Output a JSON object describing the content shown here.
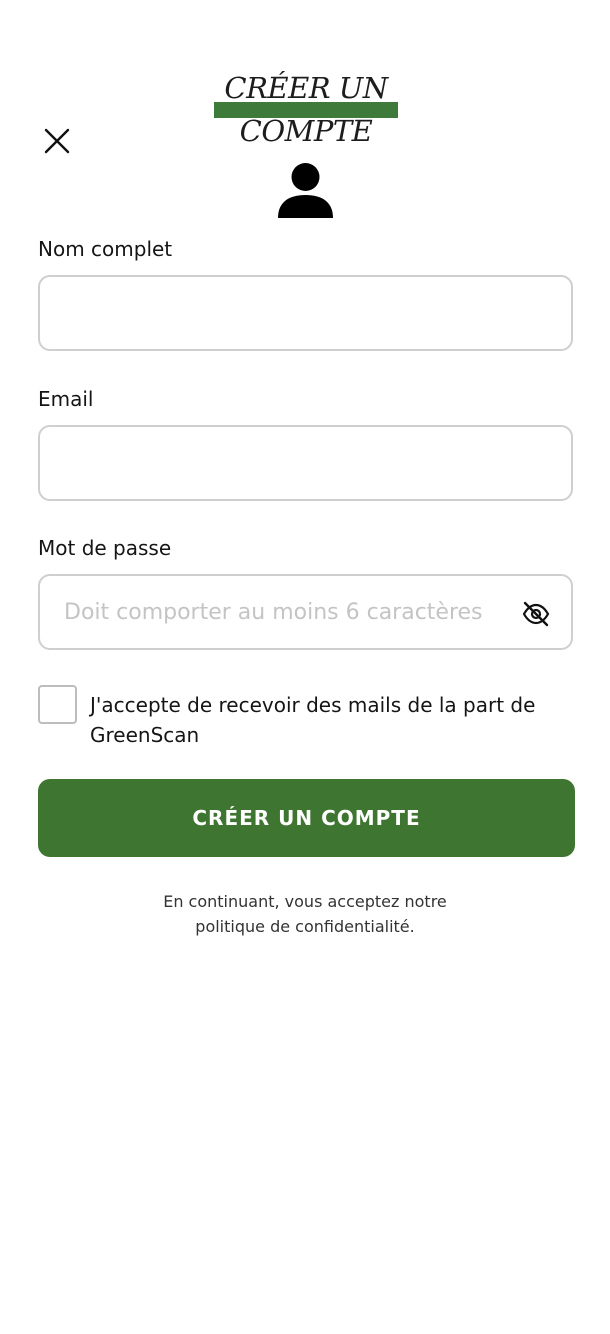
{
  "header": {
    "title_line1": "CRÉER UN",
    "title_line2": "COMPTE",
    "accent_color": "#3e7a3a"
  },
  "icons": {
    "close": "close-icon",
    "avatar": "person-icon",
    "password_visibility": "eye-off-icon"
  },
  "form": {
    "name_label": "Nom complet",
    "name_value": "",
    "email_label": "Email",
    "email_value": "",
    "password_label": "Mot de passe",
    "password_value": "",
    "password_placeholder": "Doit comporter au moins 6 caractères",
    "newsletter_label": "J'accepte de recevoir des mails de la part de GreenScan",
    "newsletter_checked": false
  },
  "actions": {
    "submit_label": "CRÉER UN COMPTE",
    "submit_color": "#3e7531"
  },
  "footer": {
    "line1": "En continuant, vous acceptez notre",
    "line2": "politique de confidentialité."
  }
}
